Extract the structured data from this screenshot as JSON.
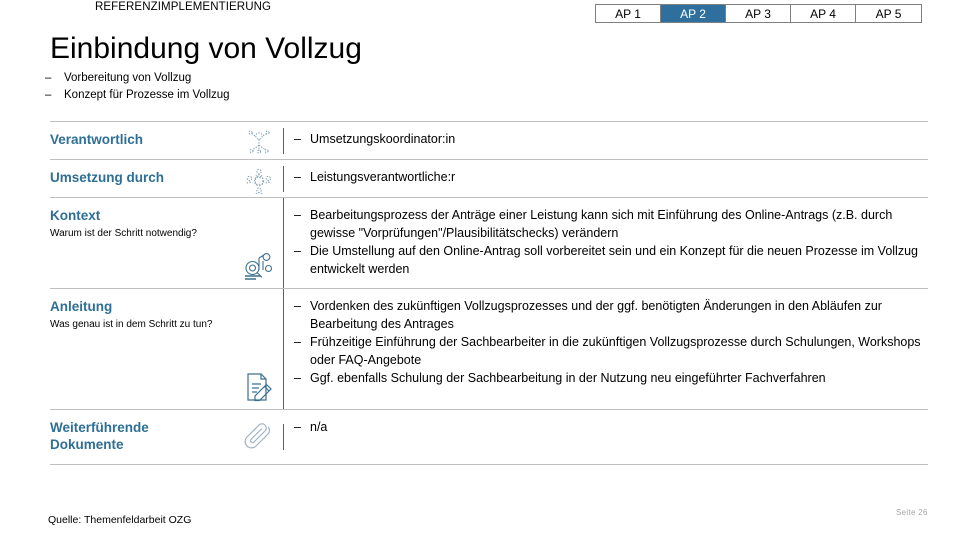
{
  "header": {
    "eyebrow": "REFERENZIMPLEMENTIERUNG",
    "title": "Einbindung von Vollzug",
    "dash": "–",
    "subtitles": [
      "Vorbereitung von Vollzug",
      "Konzept für Prozesse im Vollzug"
    ]
  },
  "tabs": [
    {
      "label": "AP 1",
      "active": false
    },
    {
      "label": "AP 2",
      "active": true
    },
    {
      "label": "AP 3",
      "active": false
    },
    {
      "label": "AP 4",
      "active": false
    },
    {
      "label": "AP 5",
      "active": false
    }
  ],
  "colors": {
    "accent": "#2e6f96",
    "tab_active_bg": "#2e6f9e",
    "divider": "#bfbfbf",
    "page_number": "#a6a6a6"
  },
  "rows": {
    "verantwortlich": {
      "label": "Verantwortlich",
      "icon": "person-network-icon",
      "bullets": [
        "Umsetzungskoordinator:in"
      ]
    },
    "umsetzung_durch": {
      "label": "Umsetzung durch",
      "icon": "people-group-icon",
      "bullets": [
        "Leistungsverantwortliche:r"
      ]
    },
    "kontext": {
      "label": "Kontext",
      "sublabel": "Warum ist der Schritt notwendig?",
      "icon": "magnifier-document-icon",
      "bullets": [
        "Bearbeitungsprozess der Anträge einer Leistung kann sich mit Einführung des Online-Antrags (z.B. durch gewisse \"Vorprüfungen\"/Plausibilitätschecks) verändern",
        "Die Umstellung auf den Online-Antrag soll vorbereitet sein und ein Konzept für die neuen Prozesse im Vollzug entwickelt werden"
      ]
    },
    "anleitung": {
      "label": "Anleitung",
      "sublabel": "Was genau ist in dem Schritt zu tun?",
      "icon": "document-pencil-icon",
      "bullets": [
        "Vordenken des zukünftigen Vollzugsprozesses und der ggf. benötigten Änderungen in den Abläufen zur Bearbeitung des Antrages",
        "Frühzeitige Einführung der Sachbearbeiter in die zukünftigen Vollzugsprozesse durch Schulungen, Workshops oder FAQ-Angebote",
        "Ggf. ebenfalls Schulung der Sachbearbeitung in der Nutzung neu eingeführter Fachverfahren"
      ]
    },
    "weiterfuehrende": {
      "label": "Weiterführende Dokumente",
      "icon": "paperclip-icon",
      "bullets": [
        "n/a"
      ]
    }
  },
  "footer": {
    "source": "Quelle: Themenfeldarbeit OZG",
    "page_number": "Seite 26"
  }
}
